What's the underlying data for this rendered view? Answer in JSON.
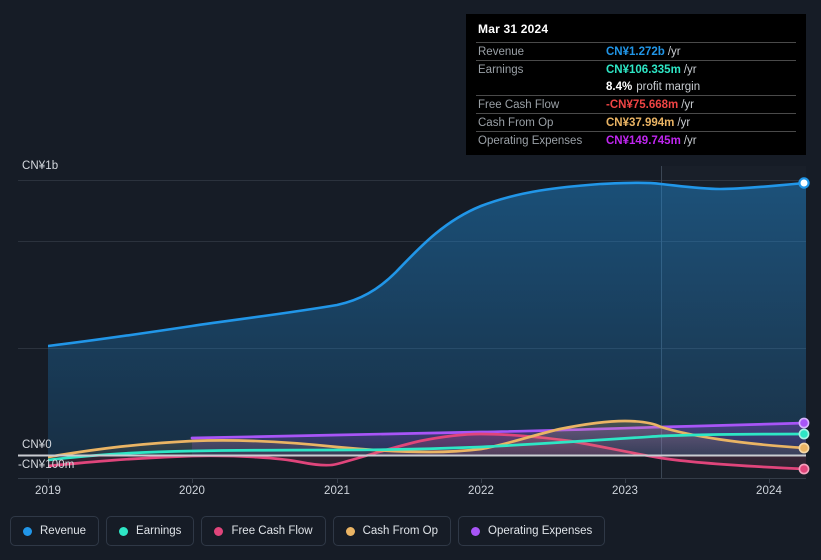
{
  "chart_data": {
    "type": "area",
    "title": "",
    "xlabel": "",
    "ylabel": "",
    "currency": "CN¥",
    "grid": true,
    "legend_position": "bottom",
    "x_tick_labels": [
      "2019",
      "2020",
      "2021",
      "2022",
      "2023",
      "2024"
    ],
    "y_tick_labels": [
      "CN¥1b",
      "CN¥0",
      "-CN¥100m"
    ],
    "ylim": [
      -100000000,
      1300000000
    ],
    "y_gridlines": [
      "CN¥1b",
      "CN¥0"
    ],
    "zero_line": "CN¥0",
    "series": [
      {
        "name": "Revenue",
        "color": "#2196e8",
        "end_value_label": "CN¥1.272b",
        "values": [
          390,
          400,
          412,
          424,
          437,
          450,
          462,
          472,
          480,
          487,
          495,
          505,
          523,
          570,
          660,
          770,
          870,
          950,
          1010,
          1060,
          1100,
          1140,
          1175,
          1210,
          1240,
          1255,
          1248,
          1235,
          1232,
          1240,
          1252,
          1262,
          1268,
          1272
        ]
      },
      {
        "name": "Earnings",
        "color": "#2ee6c5",
        "end_value_label": "CN¥106.335m",
        "values": [
          -14,
          -10,
          -6,
          -2,
          2,
          5,
          7,
          8,
          8,
          7,
          6,
          5,
          5,
          6,
          8,
          10,
          12,
          14,
          16,
          18,
          22,
          28,
          34,
          40,
          46,
          52,
          58,
          66,
          74,
          82,
          90,
          97,
          102,
          106.335
        ]
      },
      {
        "name": "Free Cash Flow",
        "color": "#e0457b",
        "end_value_label": "-CN¥75.668m",
        "values": [
          -40,
          -36,
          -31,
          -26,
          -21,
          -16,
          -11,
          -7,
          -4,
          -2,
          -1,
          -2,
          -5,
          -10,
          -18,
          -25,
          -30,
          -32,
          -28,
          -18,
          -5,
          8,
          18,
          24,
          26,
          24,
          18,
          8,
          -6,
          -22,
          -38,
          -54,
          -66,
          -75.668
        ]
      },
      {
        "name": "Cash From Op",
        "color": "#eab464",
        "end_value_label": "CN¥37.994m",
        "values": [
          -8,
          -2,
          5,
          12,
          19,
          25,
          30,
          34,
          36,
          37,
          36,
          33,
          28,
          22,
          15,
          9,
          5,
          3,
          4,
          8,
          16,
          28,
          42,
          54,
          62,
          64,
          60,
          54,
          48,
          44,
          42,
          40,
          39,
          37.994
        ]
      },
      {
        "name": "Operating Expenses",
        "color": "#a855f7",
        "end_value_label": "CN¥149.745m",
        "values": [
          null,
          null,
          null,
          null,
          null,
          null,
          null,
          null,
          null,
          8,
          10,
          12,
          14,
          16,
          18,
          21,
          24,
          28,
          33,
          40,
          48,
          57,
          66,
          75,
          84,
          93,
          101,
          110,
          118,
          126,
          133,
          140,
          146,
          149.745
        ]
      }
    ]
  },
  "tooltip": {
    "date": "Mar 31 2024",
    "rows": [
      {
        "key": "Revenue",
        "value": "CN¥1.272b",
        "unit": "/yr",
        "color": "#2196e8"
      },
      {
        "key": "Earnings",
        "value": "CN¥106.335m",
        "unit": "/yr",
        "color": "#2ee6c5"
      },
      {
        "key": "",
        "value": "8.4%",
        "sub": "profit margin",
        "color": "#ffffff"
      },
      {
        "key": "Free Cash Flow",
        "value": "-CN¥75.668m",
        "unit": "/yr",
        "color": "#ef4444"
      },
      {
        "key": "Cash From Op",
        "value": "CN¥37.994m",
        "unit": "/yr",
        "color": "#eab464"
      },
      {
        "key": "Operating Expenses",
        "value": "CN¥149.745m",
        "unit": "/yr",
        "color": "#c026f0"
      }
    ]
  },
  "legend": {
    "items": [
      {
        "label": "Revenue",
        "color": "#2196e8"
      },
      {
        "label": "Earnings",
        "color": "#2ee6c5"
      },
      {
        "label": "Free Cash Flow",
        "color": "#e0457b"
      },
      {
        "label": "Cash From Op",
        "color": "#eab464"
      },
      {
        "label": "Operating Expenses",
        "color": "#a855f7"
      }
    ]
  },
  "axes": {
    "y_top": "CN¥1b",
    "y_zero": "CN¥0",
    "y_bottom": "-CN¥100m",
    "x": [
      "2019",
      "2020",
      "2021",
      "2022",
      "2023",
      "2024"
    ]
  }
}
